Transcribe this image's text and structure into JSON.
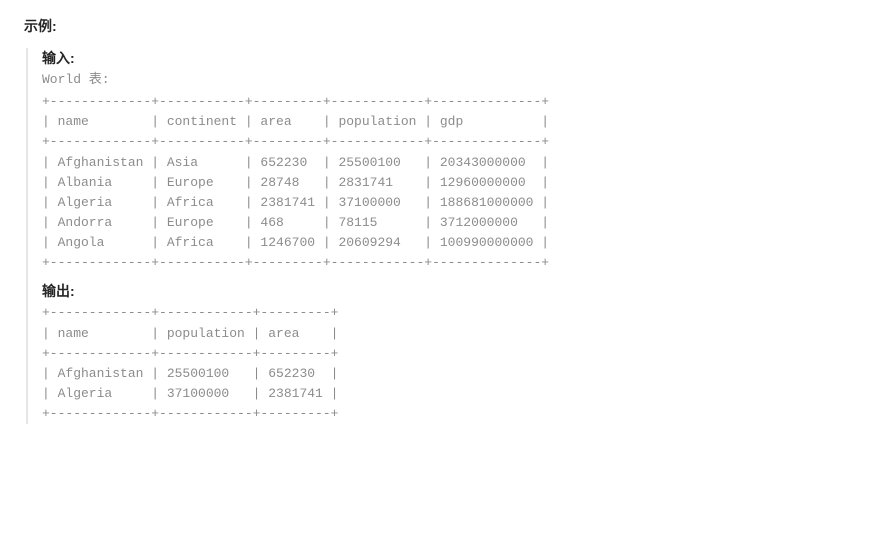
{
  "example_label": "示例:",
  "input_label": "输入:",
  "output_label": "输出:",
  "input_caption": "World 表:",
  "input_table": {
    "columns": [
      "name",
      "continent",
      "area",
      "population",
      "gdp"
    ],
    "widths": [
      13,
      11,
      9,
      12,
      14
    ],
    "rows": [
      [
        "Afghanistan",
        "Asia",
        "652230",
        "25500100",
        "20343000000"
      ],
      [
        "Albania",
        "Europe",
        "28748",
        "2831741",
        "12960000000"
      ],
      [
        "Algeria",
        "Africa",
        "2381741",
        "37100000",
        "188681000000"
      ],
      [
        "Andorra",
        "Europe",
        "468",
        "78115",
        "3712000000"
      ],
      [
        "Angola",
        "Africa",
        "1246700",
        "20609294",
        "100990000000"
      ]
    ]
  },
  "output_table": {
    "columns": [
      "name",
      "population",
      "area"
    ],
    "widths": [
      13,
      12,
      9
    ],
    "rows": [
      [
        "Afghanistan",
        "25500100",
        "652230"
      ],
      [
        "Algeria",
        "37100000",
        "2381741"
      ]
    ]
  },
  "chart_data": [
    {
      "type": "table",
      "title": "World 表",
      "columns": [
        "name",
        "continent",
        "area",
        "population",
        "gdp"
      ],
      "rows": [
        {
          "name": "Afghanistan",
          "continent": "Asia",
          "area": 652230,
          "population": 25500100,
          "gdp": 20343000000
        },
        {
          "name": "Albania",
          "continent": "Europe",
          "area": 28748,
          "population": 2831741,
          "gdp": 12960000000
        },
        {
          "name": "Algeria",
          "continent": "Africa",
          "area": 2381741,
          "population": 37100000,
          "gdp": 188681000000
        },
        {
          "name": "Andorra",
          "continent": "Europe",
          "area": 468,
          "population": 78115,
          "gdp": 3712000000
        },
        {
          "name": "Angola",
          "continent": "Africa",
          "area": 1246700,
          "population": 20609294,
          "gdp": 100990000000
        }
      ]
    },
    {
      "type": "table",
      "title": "输出",
      "columns": [
        "name",
        "population",
        "area"
      ],
      "rows": [
        {
          "name": "Afghanistan",
          "population": 25500100,
          "area": 652230
        },
        {
          "name": "Algeria",
          "population": 37100000,
          "area": 2381741
        }
      ]
    }
  ]
}
